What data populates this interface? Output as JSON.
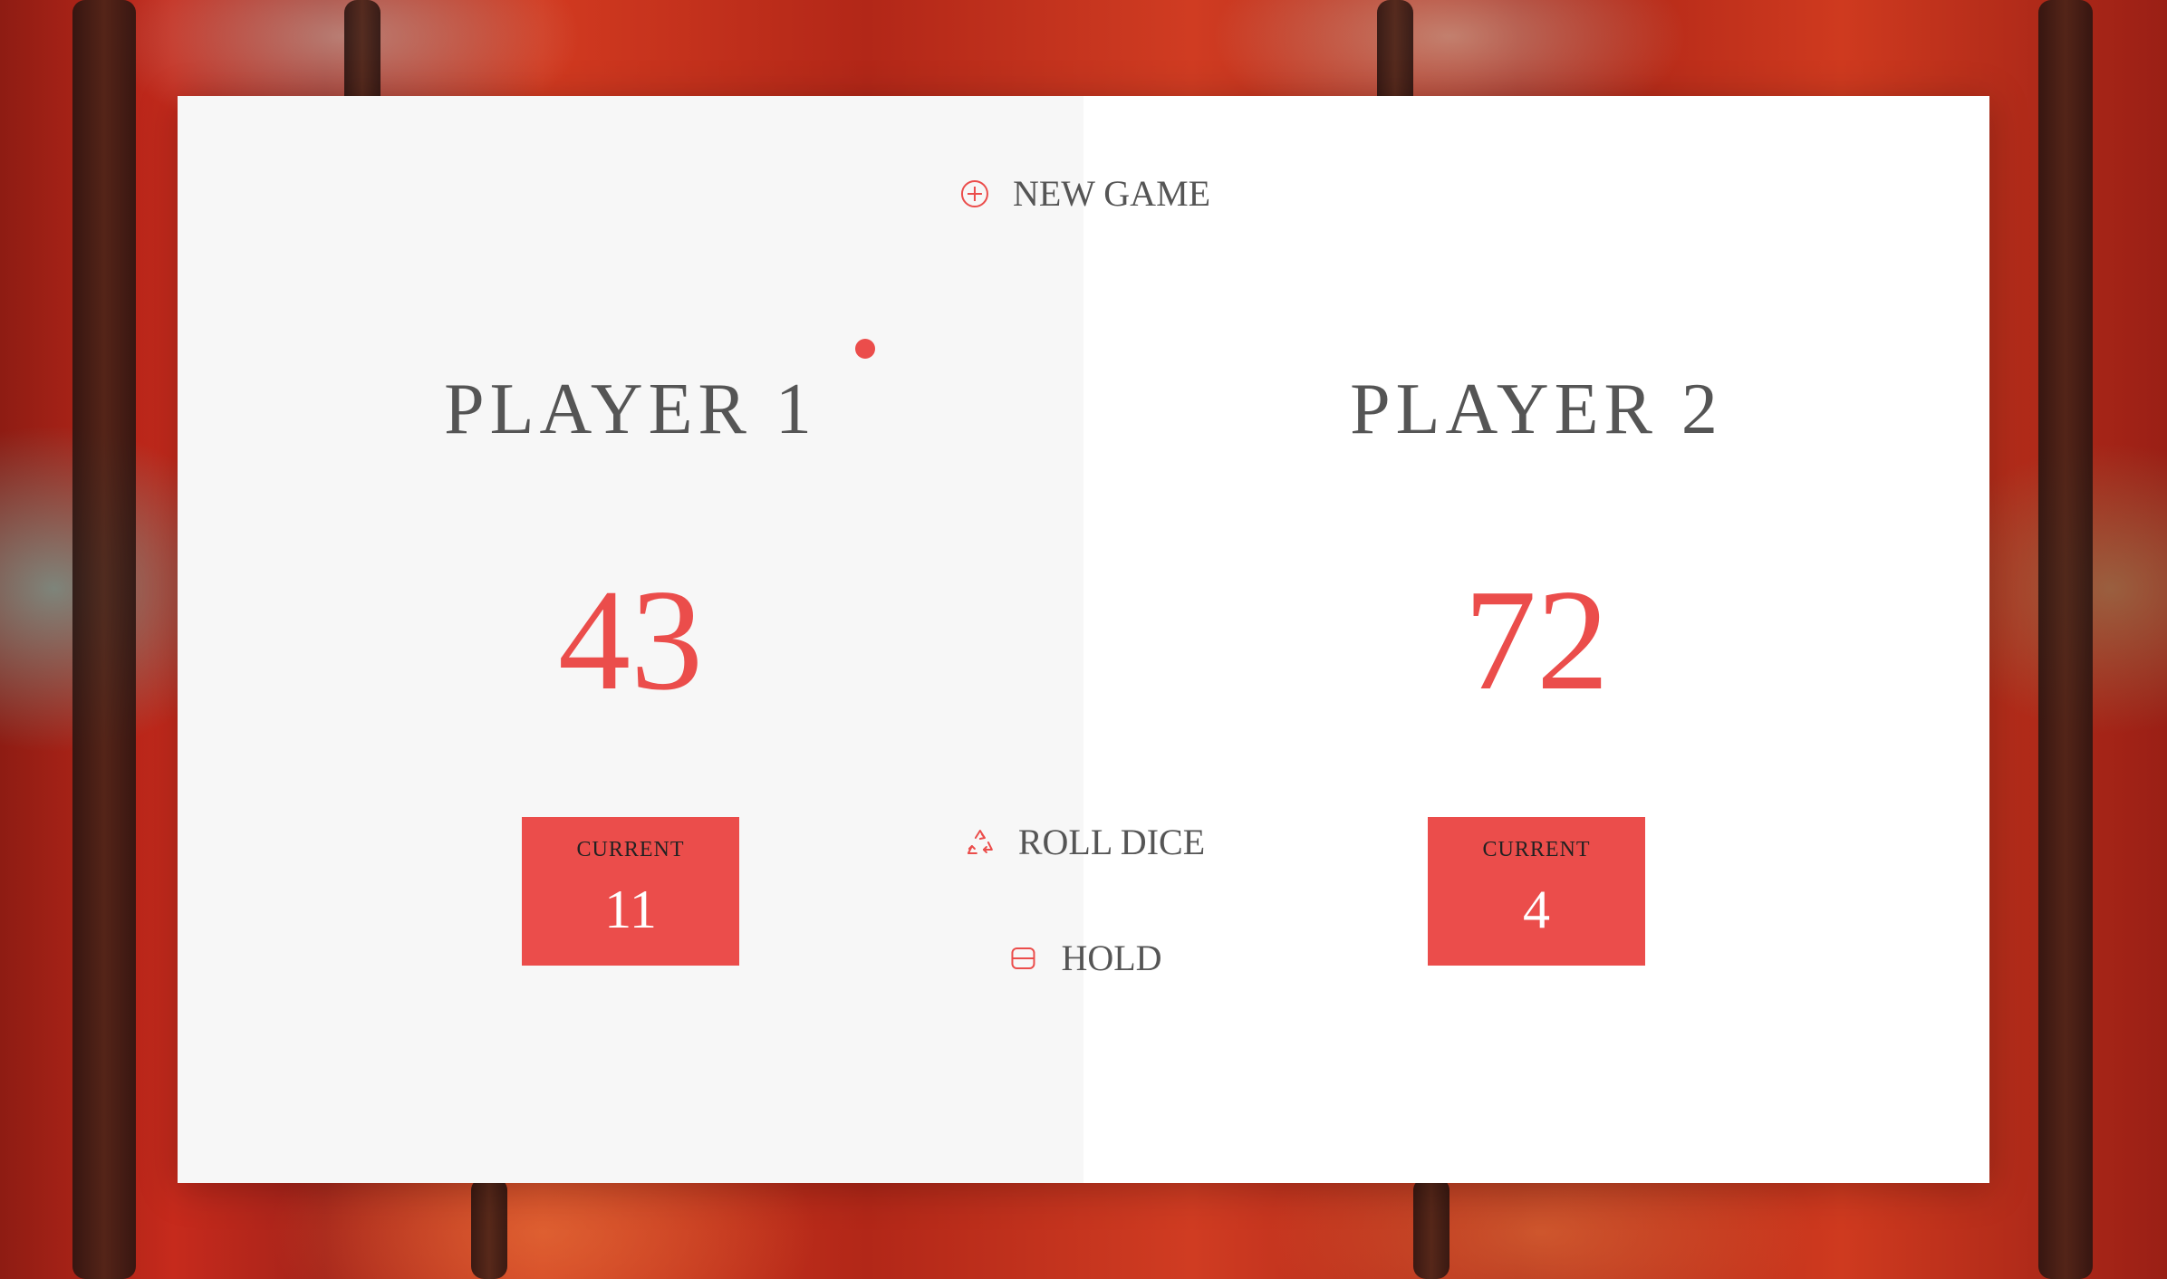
{
  "game": {
    "accent_color": "#eb4d4b",
    "active_player": 1
  },
  "controls": {
    "new_game_label": "NEW GAME",
    "new_game_icon": "plus-circle-icon",
    "roll_dice_label": "ROLL DICE",
    "roll_dice_icon": "recycle-icon",
    "hold_label": "HOLD",
    "hold_icon": "download-tray-icon"
  },
  "players": [
    {
      "name": "PLAYER 1",
      "score": "43",
      "current_label": "CURRENT",
      "current_score": "11"
    },
    {
      "name": "PLAYER 2",
      "score": "72",
      "current_label": "CURRENT",
      "current_score": "4"
    }
  ]
}
